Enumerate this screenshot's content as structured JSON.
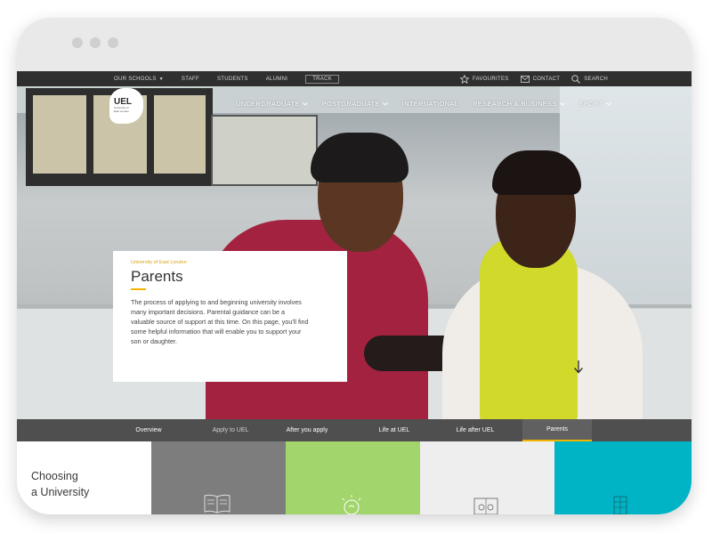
{
  "utility_bar": {
    "schools": "OUR SCHOOLS",
    "items": [
      "STAFF",
      "STUDENTS",
      "ALUMNI"
    ],
    "track": "TRACK",
    "favourites": "FAVOURITES",
    "contact": "CONTACT",
    "search": "SEARCH"
  },
  "logo": {
    "main": "UEL",
    "sub_line1": "University of",
    "sub_line2": "East London"
  },
  "main_nav": {
    "undergraduate": "UNDERGRADUATE",
    "postgraduate": "POSTGRADUATE",
    "international": "INTERNATIONAL",
    "research": "RESEARCH & BUSINESS",
    "sport": "SPORT"
  },
  "intro": {
    "eyebrow": "University of East London",
    "title": "Parents",
    "body": "The process of applying to and beginning university involves many important decisions. Parental guidance can be a valuable source of support at this time. On this page, you'll find some helpful information that will enable you to support your son or daughter."
  },
  "tabs": {
    "overview": "Overview",
    "apply": "Apply to UEL",
    "after_apply": "After you apply",
    "life": "Life at UEL",
    "life_after": "Life after UEL",
    "parents": "Parents"
  },
  "tiles": {
    "first_heading_line1": "Choosing",
    "first_heading_line2": "a University",
    "icons": [
      "book-icon",
      "lightbulb-icon",
      "board-icon",
      "building-icon"
    ]
  },
  "colors": {
    "utility_bg": "#2f2f2f",
    "tabs_bg": "#4f4f4f",
    "accent": "#f2b400",
    "tile_grey": "#7d7d7d",
    "tile_green": "#a2d56c",
    "tile_light": "#eeeeee",
    "tile_teal": "#00b4c6"
  }
}
